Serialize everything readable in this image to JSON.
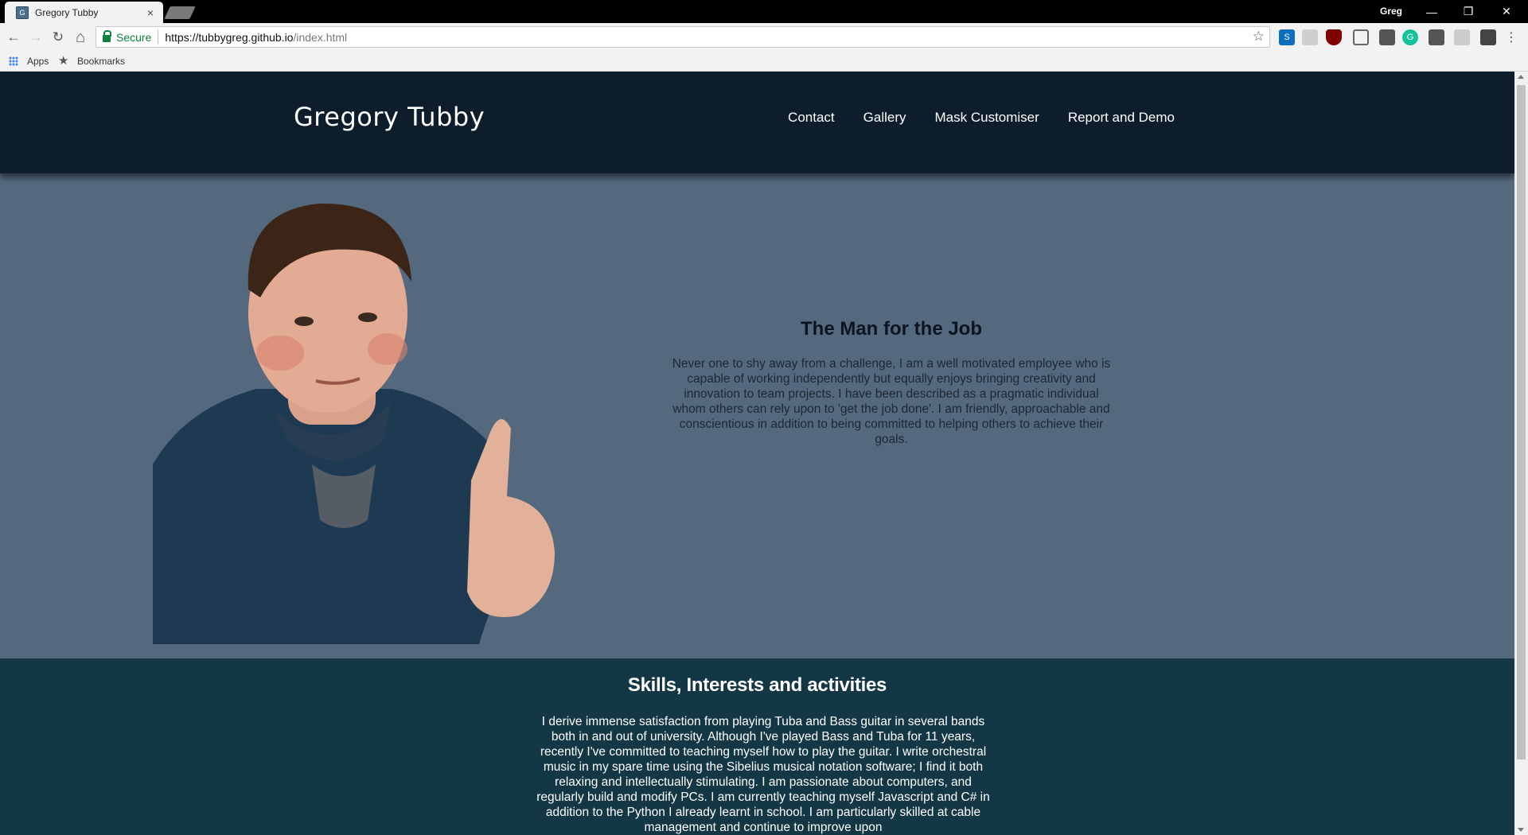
{
  "browser": {
    "tab_title": "Gregory Tubby",
    "tab_close": "×",
    "profile_name": "Greg",
    "window_controls": {
      "minimize": "—",
      "restore": "❐",
      "close": "✕"
    },
    "nav_icons": {
      "back": "←",
      "forward": "→",
      "reload": "↻",
      "home": "⌂"
    },
    "security_label": "Secure",
    "url_host": "https://tubbygreg.github.io",
    "url_path": "/index.html",
    "bookmark_star": "☆",
    "bookmarks_bar": {
      "apps_label": "Apps",
      "bookmarks_label": "Bookmarks"
    },
    "extensions": [
      "skype-ext-icon",
      "screen-ext-icon",
      "ublock-icon",
      "cast-icon",
      "tampermonkey-icon",
      "grammarly-icon",
      "mail-ext-icon",
      "sync-ext-icon",
      "rocket-ext-icon",
      "menu-icon"
    ]
  },
  "site": {
    "logo": "Gregory Tubby",
    "nav": [
      {
        "label": "Contact"
      },
      {
        "label": "Gallery"
      },
      {
        "label": "Mask Customiser"
      },
      {
        "label": "Report and Demo"
      }
    ],
    "hero": {
      "title": "The Man for the Job",
      "text": "Never one to shy away from a challenge, I am a well motivated employee who is capable of working independently but equally enjoys bringing creativity and innovation to team projects. I have been described as a pragmatic individual whom others can rely upon to 'get the job done'. I am friendly, approachable and conscientious in addition to being committed to helping others to achieve their goals."
    },
    "skills": {
      "title": "Skills, Interests and activities",
      "text": "I derive immense satisfaction from playing Tuba and Bass guitar in several bands both in and out of university. Although I've played Bass and Tuba for 11 years, recently I've committed to teaching myself how to play the guitar. I write orchestral music in my spare time using the Sibelius musical notation software; I find it both relaxing and intellectually stimulating. I am passionate about computers, and regularly build and modify PCs. I am currently teaching myself Javascript and C# in addition to the Python I already learnt in school. I am particularly skilled at cable management and continue to improve upon"
    }
  },
  "colors": {
    "header_bg": "#0d1d2c",
    "hero_bg": "#54687e",
    "skills_bg": "#143746",
    "secure_green": "#0b8043"
  }
}
